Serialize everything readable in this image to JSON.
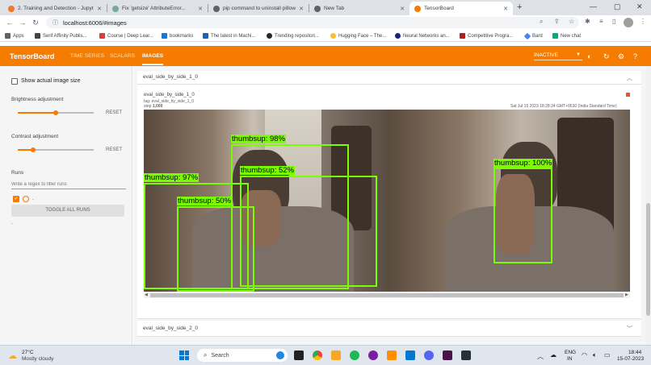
{
  "browser": {
    "tabs": [
      {
        "title": "2. Training and Detection - Jupyt",
        "favicon_color": "#f37726"
      },
      {
        "title": "Fix 'getsize' AttributeError...",
        "favicon_color": "#74aa9c"
      },
      {
        "title": "pip command to uninstall pillow",
        "favicon_color": "#5f6368"
      },
      {
        "title": "New Tab",
        "favicon_color": "#5f6368"
      },
      {
        "title": "TensorBoard",
        "favicon_color": "#f57c00"
      }
    ],
    "new_tab": "+",
    "url": "localhost:6006/#images",
    "bookmarks": [
      {
        "label": "Apps",
        "color": "#5f6368"
      },
      {
        "label": "Serif Affinity Publis...",
        "color": "#444444"
      },
      {
        "label": "Course | Deep Lear...",
        "color": "#e53935"
      },
      {
        "label": "bookmarks",
        "color": "#1976d2"
      },
      {
        "label": "The latest in Machi...",
        "color": "#1565c0"
      },
      {
        "label": "Trending repositori...",
        "color": "#24292e"
      },
      {
        "label": "Hugging Face – The...",
        "color": "#fbc02d"
      },
      {
        "label": "Neural Networks an...",
        "color": "#1a237e"
      },
      {
        "label": "Competitive Progra...",
        "color": "#b71c1c"
      },
      {
        "label": "Bard",
        "color": "#4285f4"
      },
      {
        "label": "New chat",
        "color": "#10a37f"
      }
    ]
  },
  "tensorboard": {
    "logo": "TensorBoard",
    "nav_tabs": [
      {
        "label": "TIME SERIES",
        "active": false
      },
      {
        "label": "SCALARS",
        "active": false
      },
      {
        "label": "IMAGES",
        "active": true
      }
    ],
    "run_selector": "INACTIVE",
    "brand_color": "#f57c00"
  },
  "sidebar": {
    "show_actual_size": "Show actual image size",
    "brightness": {
      "label": "Brightness adjustment",
      "reset": "RESET",
      "level": 0.5
    },
    "contrast": {
      "label": "Contrast adjustment",
      "reset": "RESET",
      "level": 0.2
    },
    "runs_label": "Runs",
    "filter_placeholder": "Write a regex to filter runs",
    "run_item": ".",
    "toggle_all": "TOGGLE ALL RUNS",
    "footer": "."
  },
  "main": {
    "cards": [
      {
        "title": "eval_side_by_side_1_0",
        "image": {
          "name": "eval_side_by_side_1_0",
          "tag_line": "tag: eval_side_by_side_1_0",
          "step_label": "step",
          "step_value": "1,000",
          "timestamp": "Sat Jul 15 2023 18:28:34 GMT+0530 (India Standard Time)"
        },
        "detections": [
          {
            "label": "thumbsup: 98%"
          },
          {
            "label": "thumbsup: 97%"
          },
          {
            "label": "thumbsup: 52%"
          },
          {
            "label": "thumbsup: 50%"
          },
          {
            "label": "thumbsup: 100%"
          }
        ]
      },
      {
        "title": "eval_side_by_side_2_0"
      }
    ]
  },
  "taskbar": {
    "weather_temp": "27°C",
    "weather_desc": "Mostly cloudy",
    "search_placeholder": "Search",
    "lang_top": "ENG",
    "lang_bottom": "IN",
    "time": "18:44",
    "date": "15-07-2023"
  }
}
